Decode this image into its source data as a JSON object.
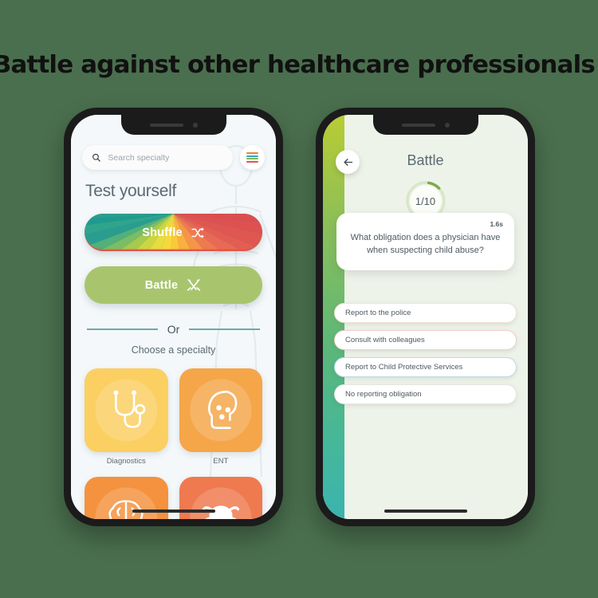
{
  "headline": "Battle against other healthcare professionals!",
  "page": {
    "background_color": "#4a6f4e"
  },
  "left_phone": {
    "search": {
      "placeholder": "Search specialty",
      "value": "",
      "icon": "search-icon"
    },
    "menu": {
      "icon": "hamburger-menu-icon",
      "bar_colors": [
        "#e8853c",
        "#3ba3b8",
        "#7fb85a",
        "#dd5a4a"
      ]
    },
    "section_title": "Test yourself",
    "shuffle_button": {
      "label": "Shuffle",
      "icon": "shuffle-icon",
      "style": "rainbow-burst"
    },
    "battle_button": {
      "label": "Battle",
      "icon": "crossed-swords-icon",
      "color": "#a8c56e"
    },
    "divider_label": "Or",
    "divider_color": "#6fa8ad",
    "choose_label": "Choose a specialty",
    "specialties": [
      {
        "label": "Diagnostics",
        "icon": "stethoscope-icon",
        "color": "#fbcf61"
      },
      {
        "label": "ENT",
        "icon": "head-profile-icon",
        "color": "#f5a council"
      },
      {
        "label": "",
        "icon": "brain-icon",
        "color": "#f4923f"
      },
      {
        "label": "",
        "icon": "crab-icon",
        "color": "#ef7a4f"
      }
    ],
    "specialty_colors": [
      "#fbcf61",
      "#f5a649",
      "#f4923f",
      "#ef7a4f"
    ]
  },
  "right_phone": {
    "back_icon": "back-arrow-icon",
    "title": "Battle",
    "progress": {
      "label": "1/10",
      "current": 1,
      "total": 10,
      "ring_color": "#7fa84f",
      "track_color": "#d9e6c8"
    },
    "question": {
      "timer": "1.6s",
      "text": "What obligation does a physician have when suspecting child abuse?"
    },
    "answers": [
      {
        "label": "Report to the police",
        "border_color": "#efe3cf"
      },
      {
        "label": "Consult with colleagues",
        "border_color": "#f2cfc9"
      },
      {
        "label": "Report to Child Protective Services",
        "border_color": "#bcd9e8"
      },
      {
        "label": "No reporting obligation",
        "border_color": "#e6e6e0"
      }
    ]
  }
}
